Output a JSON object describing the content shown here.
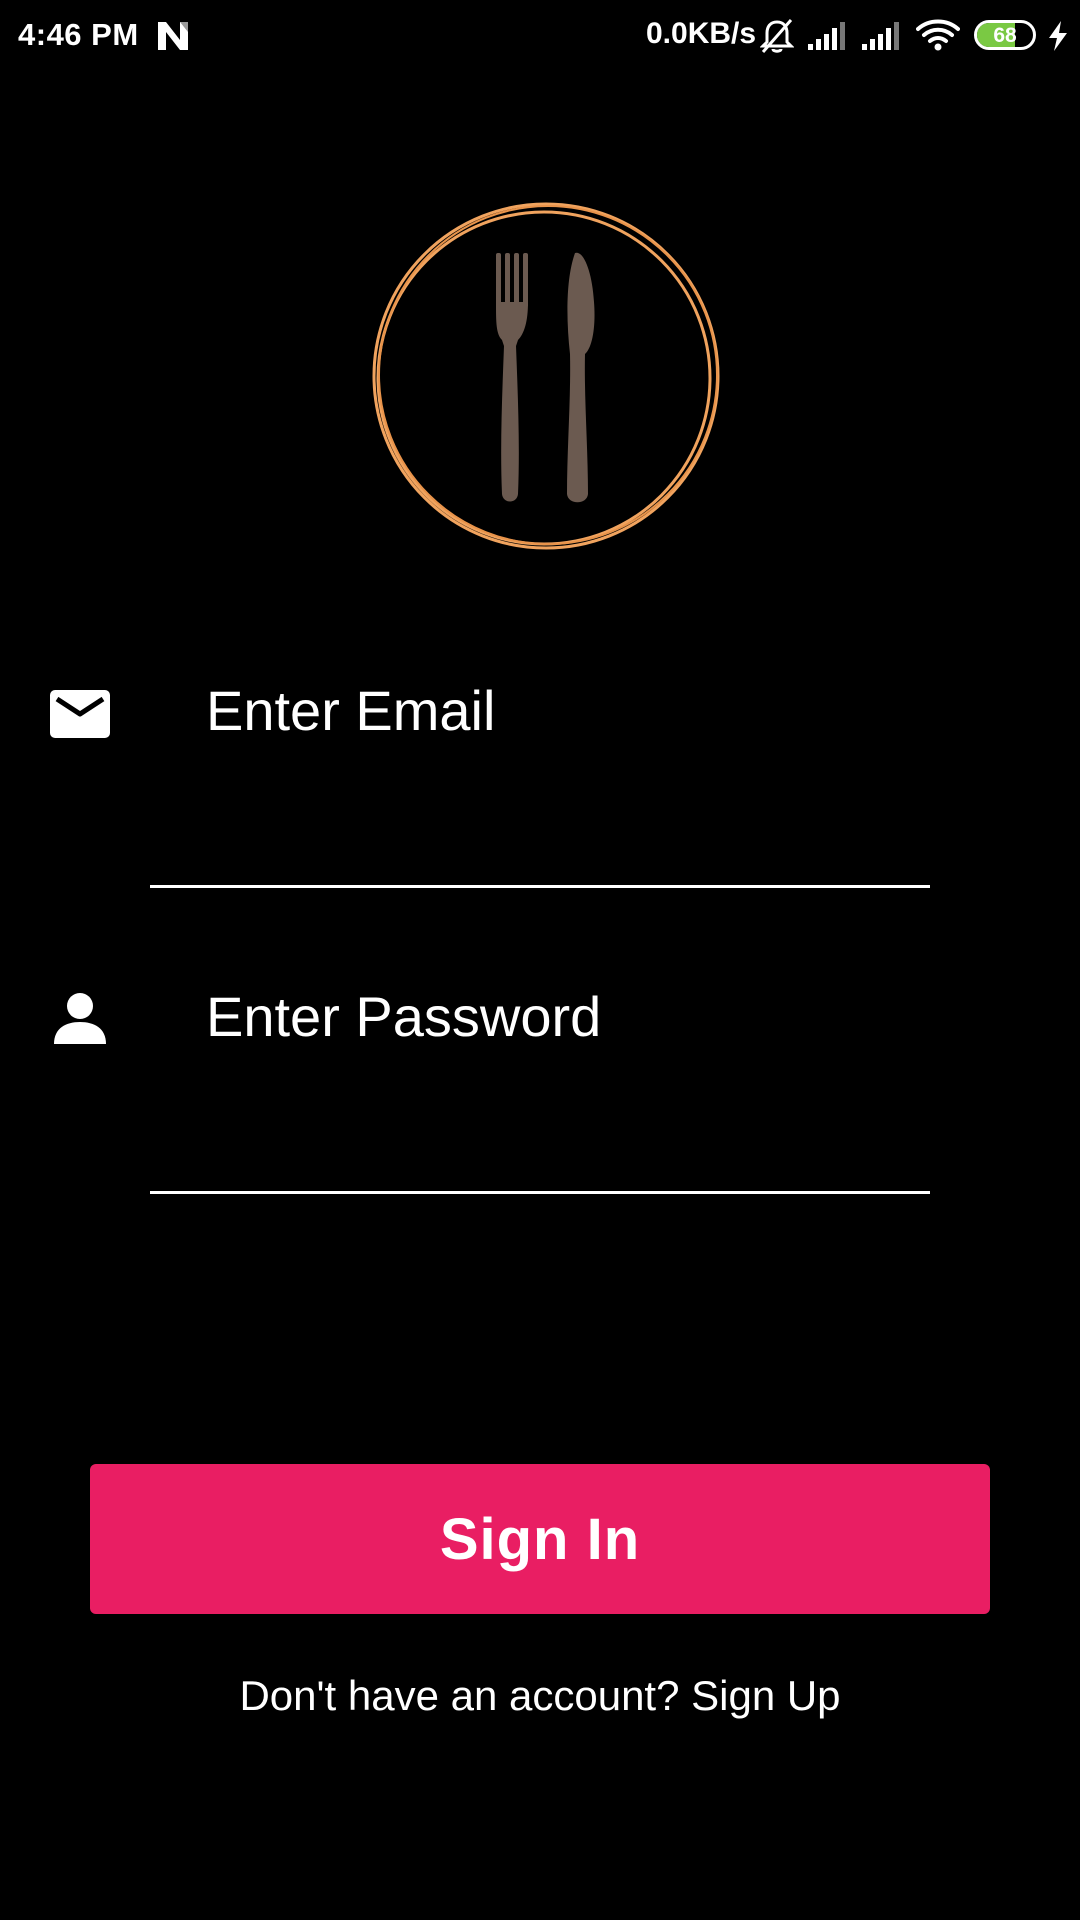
{
  "status_bar": {
    "time": "4:46 PM",
    "network_speed": "0.0KB/s",
    "battery_level": "68",
    "battery_fraction": 0.68,
    "battery_color": "#7ac943",
    "icons": [
      "n-notification-icon",
      "mute-icon",
      "signal-icon",
      "signal-icon",
      "wifi-icon",
      "battery-icon",
      "charging-icon"
    ]
  },
  "logo": {
    "icon": "fork-knife-icon",
    "ring_color": "#f0a35e",
    "utensil_color": "#6b5a50"
  },
  "form": {
    "email": {
      "icon": "mail-icon",
      "placeholder": "Enter Email",
      "value": ""
    },
    "password": {
      "icon": "person-icon",
      "placeholder": "Enter Password",
      "value": ""
    }
  },
  "actions": {
    "sign_in_label": "Sign In",
    "sign_in_color": "#e91e63",
    "signup_prompt": "Don't have an account? Sign Up"
  }
}
